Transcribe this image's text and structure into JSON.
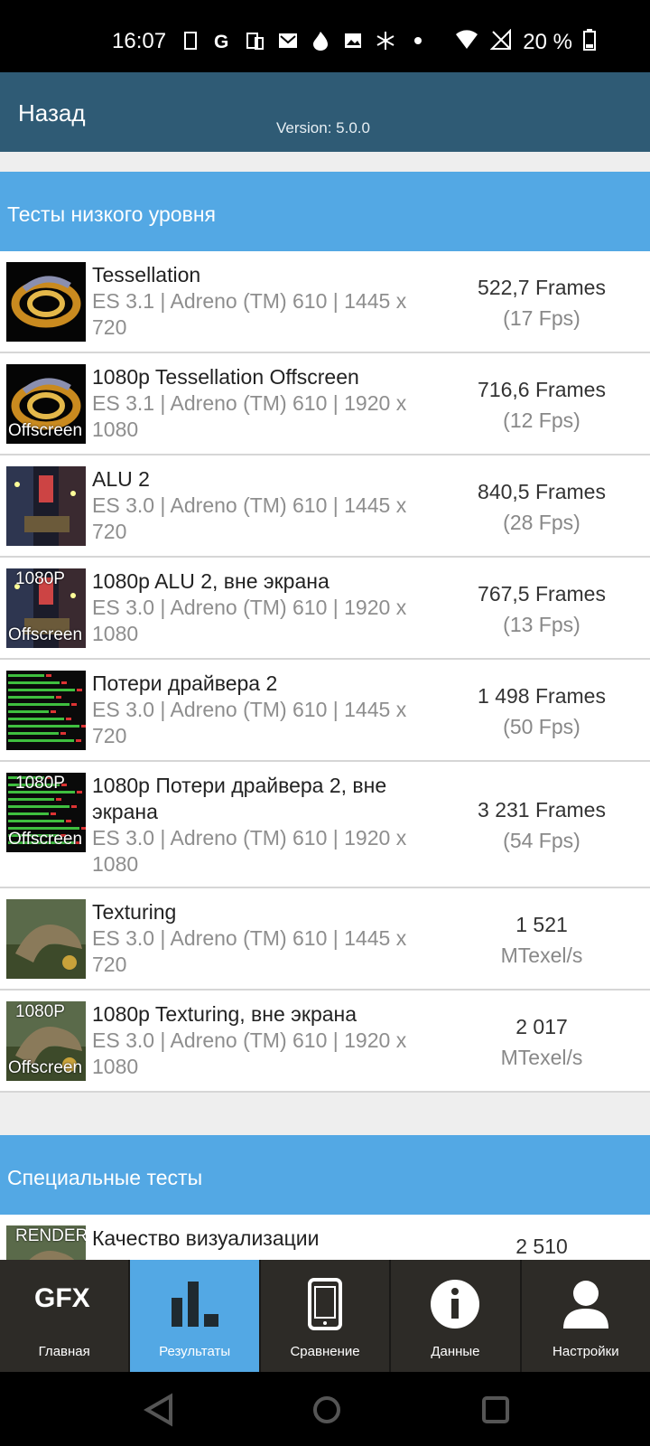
{
  "status": {
    "time": "16:07",
    "battery": "20 %"
  },
  "appbar": {
    "back_label": "Назад",
    "version": "Version: 5.0.0"
  },
  "sections": {
    "low_level": "Тесты низкого уровня",
    "special": "Специальные тесты"
  },
  "low_level_tests": [
    {
      "name": "Tessellation",
      "sub": "ES 3.1 | Adreno (TM) 610 | 1445 x 720",
      "score": "522,7 Frames",
      "fps": "(17 Fps)"
    },
    {
      "name": "1080p Tessellation Offscreen",
      "sub": "ES 3.1 | Adreno (TM) 610 | 1920 x 1080",
      "score": "716,6 Frames",
      "fps": "(12 Fps)",
      "thumb_label": "Offscreen"
    },
    {
      "name": "ALU 2",
      "sub": "ES 3.0 | Adreno (TM) 610 | 1445 x 720",
      "score": "840,5 Frames",
      "fps": "(28 Fps)"
    },
    {
      "name": "1080p ALU 2, вне экрана",
      "sub": "ES 3.0 | Adreno (TM) 610 | 1920 x 1080",
      "score": "767,5 Frames",
      "fps": "(13 Fps)",
      "thumb_top": "1080P",
      "thumb_label": "Offscreen"
    },
    {
      "name": "Потери драйвера 2",
      "sub": "ES 3.0 | Adreno (TM) 610 | 1445 x 720",
      "score": "1 498 Frames",
      "fps": "(50 Fps)"
    },
    {
      "name": "1080p Потери драйвера 2, вне экрана",
      "sub": "ES 3.0 | Adreno (TM) 610 | 1920 x 1080",
      "score": "3 231 Frames",
      "fps": "(54 Fps)",
      "thumb_top": "1080P",
      "thumb_label": "Offscreen"
    },
    {
      "name": "Texturing",
      "sub": "ES 3.0 | Adreno (TM) 610 | 1445 x 720",
      "score": "1 521",
      "fps": "MTexel/s"
    },
    {
      "name": "1080p Texturing, вне экрана",
      "sub": "ES 3.0 | Adreno (TM) 610 | 1920 x 1080",
      "score": "2 017",
      "fps": "MTexel/s",
      "thumb_top": "1080P",
      "thumb_label": "Offscreen"
    }
  ],
  "special_tests": [
    {
      "name": "Качество визуализации",
      "score": "2 510",
      "thumb_top": "RENDER"
    }
  ],
  "nav": [
    {
      "label": "Главная",
      "icon": "gfx-logo",
      "icon_text": "GFX"
    },
    {
      "label": "Результаты",
      "icon": "bar-chart-icon"
    },
    {
      "label": "Сравнение",
      "icon": "phone-icon"
    },
    {
      "label": "Данные",
      "icon": "info-icon"
    },
    {
      "label": "Настройки",
      "icon": "user-icon"
    }
  ],
  "colors": {
    "appbar": "#2f5b75",
    "section": "#53a8e4",
    "nav_bg": "#2d2b27",
    "nav_active": "#53a8e4"
  }
}
